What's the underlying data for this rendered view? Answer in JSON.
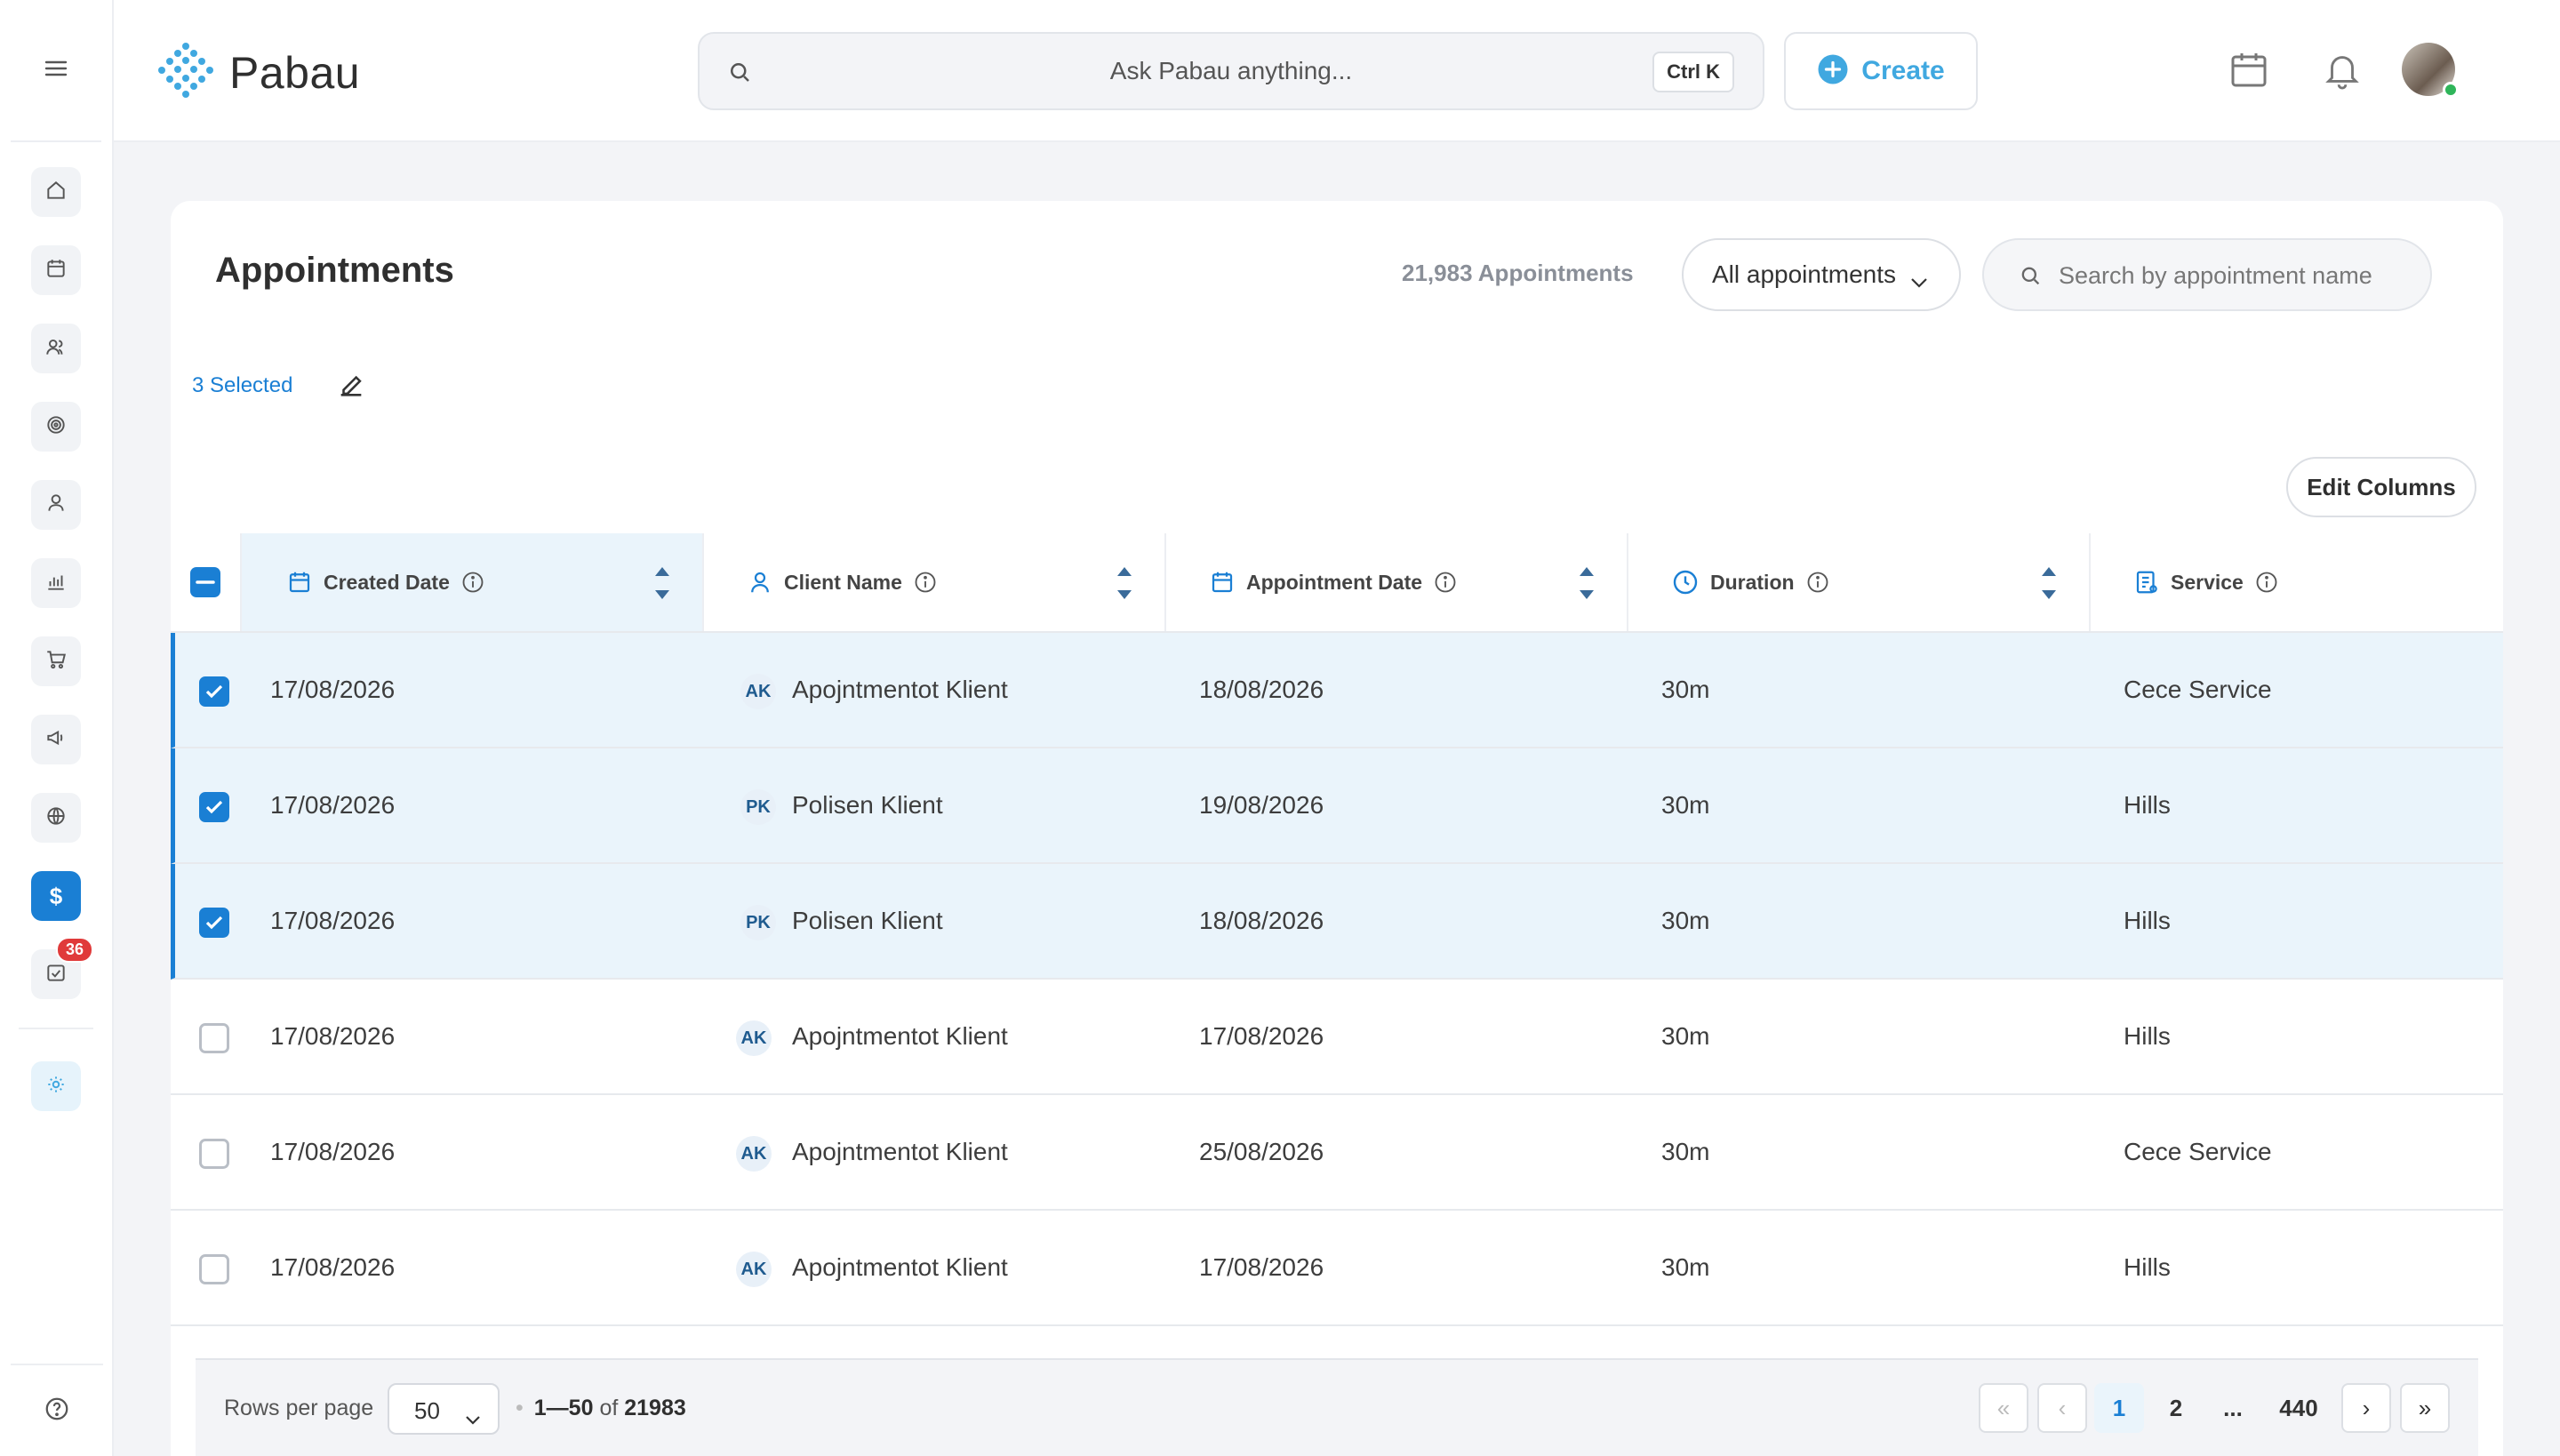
{
  "header": {
    "brand": "Pabau",
    "search_placeholder": "Ask Pabau anything...",
    "shortcut": "Ctrl K",
    "create_label": "Create"
  },
  "sidebar": {
    "badge_count": "36",
    "items": [
      "home-icon",
      "calendar-icon",
      "clients-icon",
      "target-icon",
      "user-icon",
      "reports-icon",
      "cart-icon",
      "megaphone-icon",
      "globe-icon",
      "dollar-icon",
      "tasks-icon"
    ]
  },
  "page": {
    "title": "Appointments",
    "count": "21,983 Appointments",
    "filter_label": "All appointments",
    "search_placeholder": "Search by appointment name",
    "selected_label": "3 Selected",
    "edit_columns_label": "Edit Columns"
  },
  "table": {
    "columns": [
      "Created Date",
      "Client Name",
      "Appointment Date",
      "Duration",
      "Service"
    ],
    "rows": [
      {
        "selected": true,
        "created": "17/08/2026",
        "initials": "AK",
        "client": "Apojntmentot Klient",
        "appt": "18/08/2026",
        "duration": "30m",
        "service": "Cece Service"
      },
      {
        "selected": true,
        "created": "17/08/2026",
        "initials": "PK",
        "client": "Polisen Klient",
        "appt": "19/08/2026",
        "duration": "30m",
        "service": "Hills"
      },
      {
        "selected": true,
        "created": "17/08/2026",
        "initials": "PK",
        "client": "Polisen Klient",
        "appt": "18/08/2026",
        "duration": "30m",
        "service": "Hills"
      },
      {
        "selected": false,
        "created": "17/08/2026",
        "initials": "AK",
        "client": "Apojntmentot Klient",
        "appt": "17/08/2026",
        "duration": "30m",
        "service": "Hills"
      },
      {
        "selected": false,
        "created": "17/08/2026",
        "initials": "AK",
        "client": "Apojntmentot Klient",
        "appt": "25/08/2026",
        "duration": "30m",
        "service": "Cece Service"
      },
      {
        "selected": false,
        "created": "17/08/2026",
        "initials": "AK",
        "client": "Apojntmentot Klient",
        "appt": "17/08/2026",
        "duration": "30m",
        "service": "Hills"
      }
    ]
  },
  "footer": {
    "rows_per_page_label": "Rows per page",
    "rows_per_page": "50",
    "range": "1—50",
    "of": "of",
    "total": "21983",
    "pages": [
      "1",
      "2",
      "...",
      "440"
    ],
    "first": "«",
    "prev": "‹",
    "next": "›",
    "last": "»"
  },
  "colors": {
    "accent": "#1a7fd4",
    "brand": "#40a8e0",
    "selected_row": "#eaf4fb",
    "badge": "#e03a3a"
  }
}
